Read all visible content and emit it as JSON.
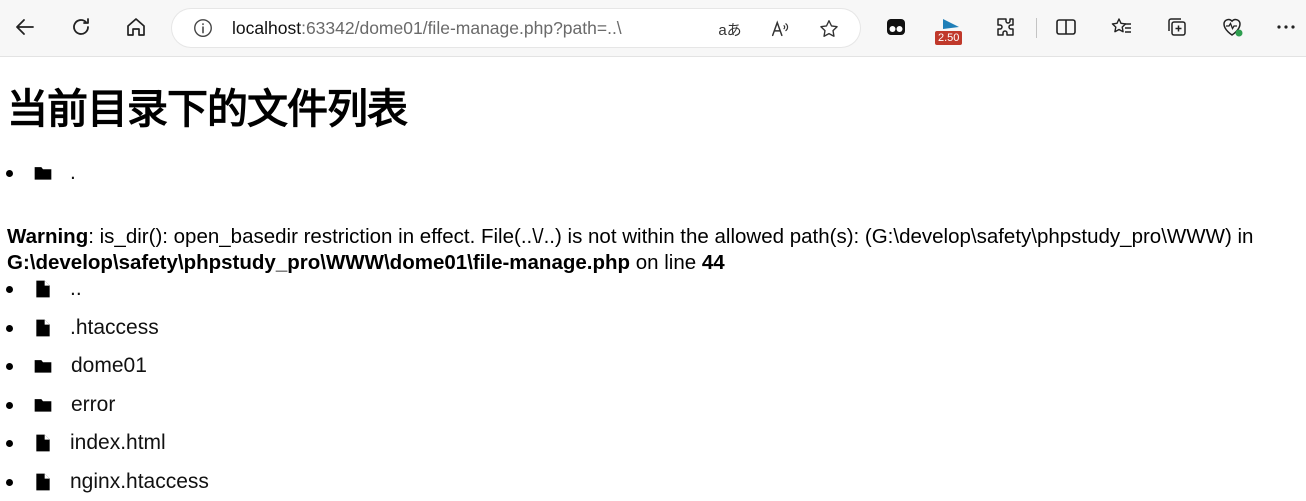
{
  "browser": {
    "url_host": "localhost",
    "url_rest": ":63342/dome01/file-manage.php?path=..\\",
    "badge": "2.50",
    "accent_color": "#1a9bb0"
  },
  "page": {
    "title": "当前目录下的文件列表",
    "entries_before": [
      {
        "name": ".",
        "type": "folder"
      }
    ],
    "warning": {
      "label": "Warning",
      "message": ": is_dir(): open_basedir restriction in effect. File(..\\/..) is not within the allowed path(s): (G:\\develop\\safety\\phpstudy_pro\\WWW) in ",
      "file": "G:\\develop\\safety\\phpstudy_pro\\WWW\\dome01\\file-manage.php",
      "on_line": " on line ",
      "line": "44"
    },
    "entries_after": [
      {
        "name": "..",
        "type": "file"
      },
      {
        "name": ".htaccess",
        "type": "file"
      },
      {
        "name": "dome01",
        "type": "folder"
      },
      {
        "name": "error",
        "type": "folder"
      },
      {
        "name": "index.html",
        "type": "file"
      },
      {
        "name": "nginx.htaccess",
        "type": "file"
      }
    ]
  }
}
